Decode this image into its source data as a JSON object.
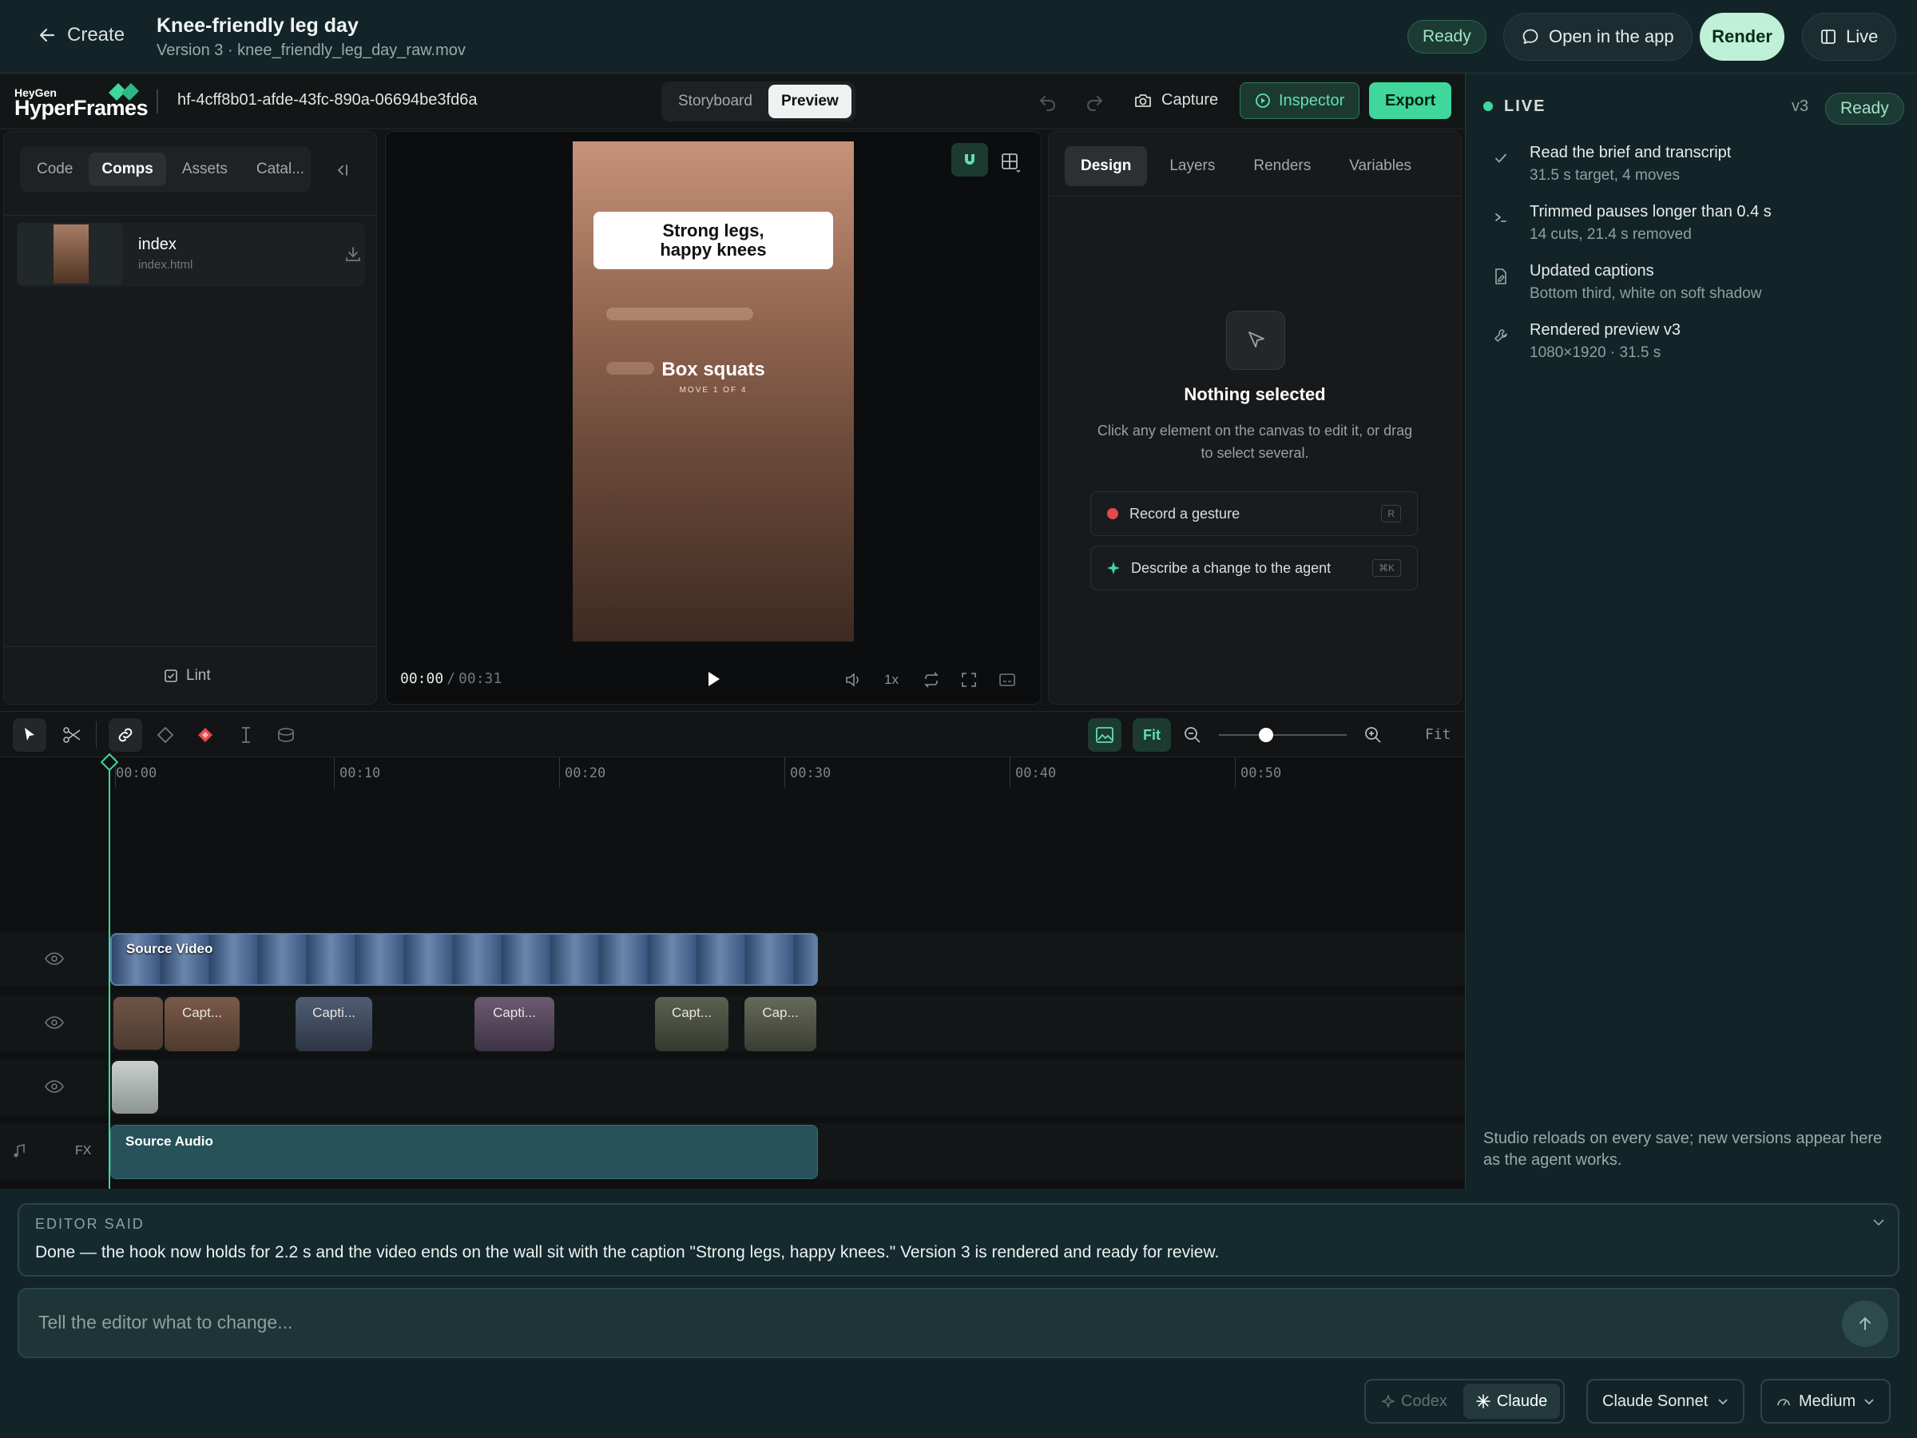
{
  "header": {
    "back_label": "Create",
    "title": "Knee-friendly leg day",
    "subtitle": "Version 3 · knee_friendly_leg_day_raw.mov",
    "status": "Ready",
    "open_app_label": "Open in the app",
    "render_label": "Render",
    "live_label": "Live"
  },
  "studio": {
    "brand_top": "HeyGen",
    "brand_main": "HyperFrames",
    "project_id": "hf-4cff8b01-afde-43fc-890a-06694be3fd6a",
    "view_tabs": [
      "Storyboard",
      "Preview"
    ],
    "capture_label": "Capture",
    "inspector_label": "Inspector",
    "export_label": "Export"
  },
  "left_panel": {
    "tabs": [
      "Code",
      "Comps",
      "Assets",
      "Catal..."
    ],
    "active_tab": "Comps",
    "comp_name": "index",
    "comp_file": "index.html",
    "lint_label": "Lint"
  },
  "preview": {
    "caption_line1": "Strong legs,",
    "caption_line2": "happy knees",
    "move_title": "Box squats",
    "move_sub": "MOVE 1 OF 4",
    "time_current": "00:00",
    "time_separator": "/",
    "time_total": "00:31",
    "speed": "1x"
  },
  "inspector": {
    "tabs": [
      "Design",
      "Layers",
      "Renders",
      "Variables"
    ],
    "active_tab": "Design",
    "empty_title": "Nothing selected",
    "empty_desc": "Click any element on the canvas to edit it, or drag to select several.",
    "record_label": "Record a gesture",
    "record_key": "R",
    "describe_label": "Describe a change to the agent",
    "describe_key": "⌘K"
  },
  "timeline": {
    "fit_label": "Fit",
    "fit_right_label": "Fit",
    "zoom_level": 0.35,
    "ticks": [
      "00:00",
      "00:10",
      "00:20",
      "00:30",
      "00:40",
      "00:50"
    ],
    "source_video_label": "Source Video",
    "source_audio_label": "Source Audio",
    "fx_label": "FX",
    "caption_clips": [
      "Capt...",
      "Capti...",
      "Capti...",
      "Capt...",
      "Cap..."
    ]
  },
  "live": {
    "label": "LIVE",
    "version": "v3",
    "status": "Ready",
    "items": [
      {
        "title": "Read the brief and transcript",
        "sub": "31.5 s target, 4 moves",
        "icon": "check-icon"
      },
      {
        "title": "Trimmed pauses longer than 0.4 s",
        "sub": "14 cuts, 21.4 s removed",
        "icon": "terminal-icon"
      },
      {
        "title": "Updated captions",
        "sub": "Bottom third, white on soft shadow",
        "icon": "file-edit-icon"
      },
      {
        "title": "Rendered preview v3",
        "sub": "1080×1920 · 31.5 s",
        "icon": "wrench-icon"
      }
    ],
    "footer": "Studio reloads on every save; new versions appear here as the agent works."
  },
  "chat": {
    "editor_said_label": "EDITOR SAID",
    "message": "Done — the hook now holds for 2.2 s and the video ends on the wall sit with the caption \"Strong legs, happy knees.\" Version 3 is rendered and ready for review.",
    "input_placeholder": "Tell the editor what to change...",
    "agents": [
      "Codex",
      "Claude"
    ],
    "active_agent": "Claude",
    "model": "Claude Sonnet",
    "effort": "Medium"
  },
  "colors": {
    "accent": "#3fd79c",
    "playhead": "#5fe0ad",
    "header_bg": "#132428",
    "studio_bg": "#111415"
  }
}
